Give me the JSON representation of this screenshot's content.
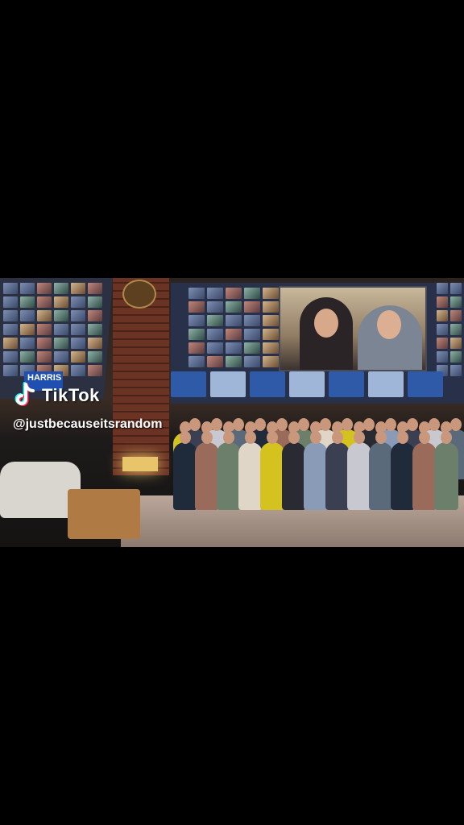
{
  "watermark": {
    "brand": "TikTok",
    "handle": "@justbecauseitsrandom",
    "logo_icon": "tiktok-logo-icon"
  },
  "video": {
    "sign_text": "HARRIS"
  },
  "colors": {
    "background": "#000000",
    "logo_cyan": "#25F4EE",
    "logo_red": "#FE2C55",
    "text": "#FFFFFF"
  }
}
